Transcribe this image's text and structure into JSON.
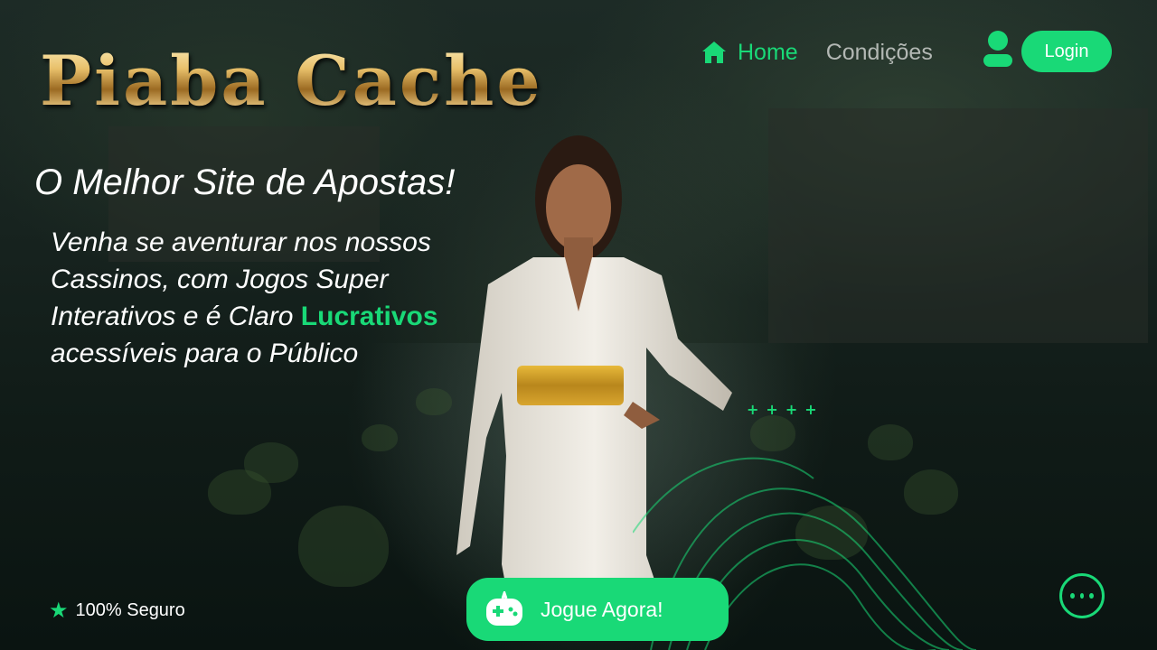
{
  "brand": {
    "logo_text": "Piaba Cache"
  },
  "nav": {
    "home_label": "Home",
    "conditions_label": "Condições",
    "login_label": "Login"
  },
  "hero": {
    "headline": "O Melhor Site de Apostas!",
    "description_before": "Venha se aventurar nos nossos Cassinos, com Jogos Super Interativos e é Claro ",
    "description_highlight": "Lucrativos",
    "description_after": " acessíveis para o Público"
  },
  "decor": {
    "plus_marks": "++++"
  },
  "footer": {
    "secure_label": "100% Seguro",
    "play_button_label": "Jogue Agora!"
  },
  "icons": {
    "home": "home-icon",
    "user": "user-icon",
    "star": "star-icon",
    "gamepad": "gamepad-icon",
    "more": "more-icon"
  },
  "colors": {
    "accent": "#19d977",
    "muted_nav": "#b3b8b4",
    "gold": "#d9b05c"
  }
}
